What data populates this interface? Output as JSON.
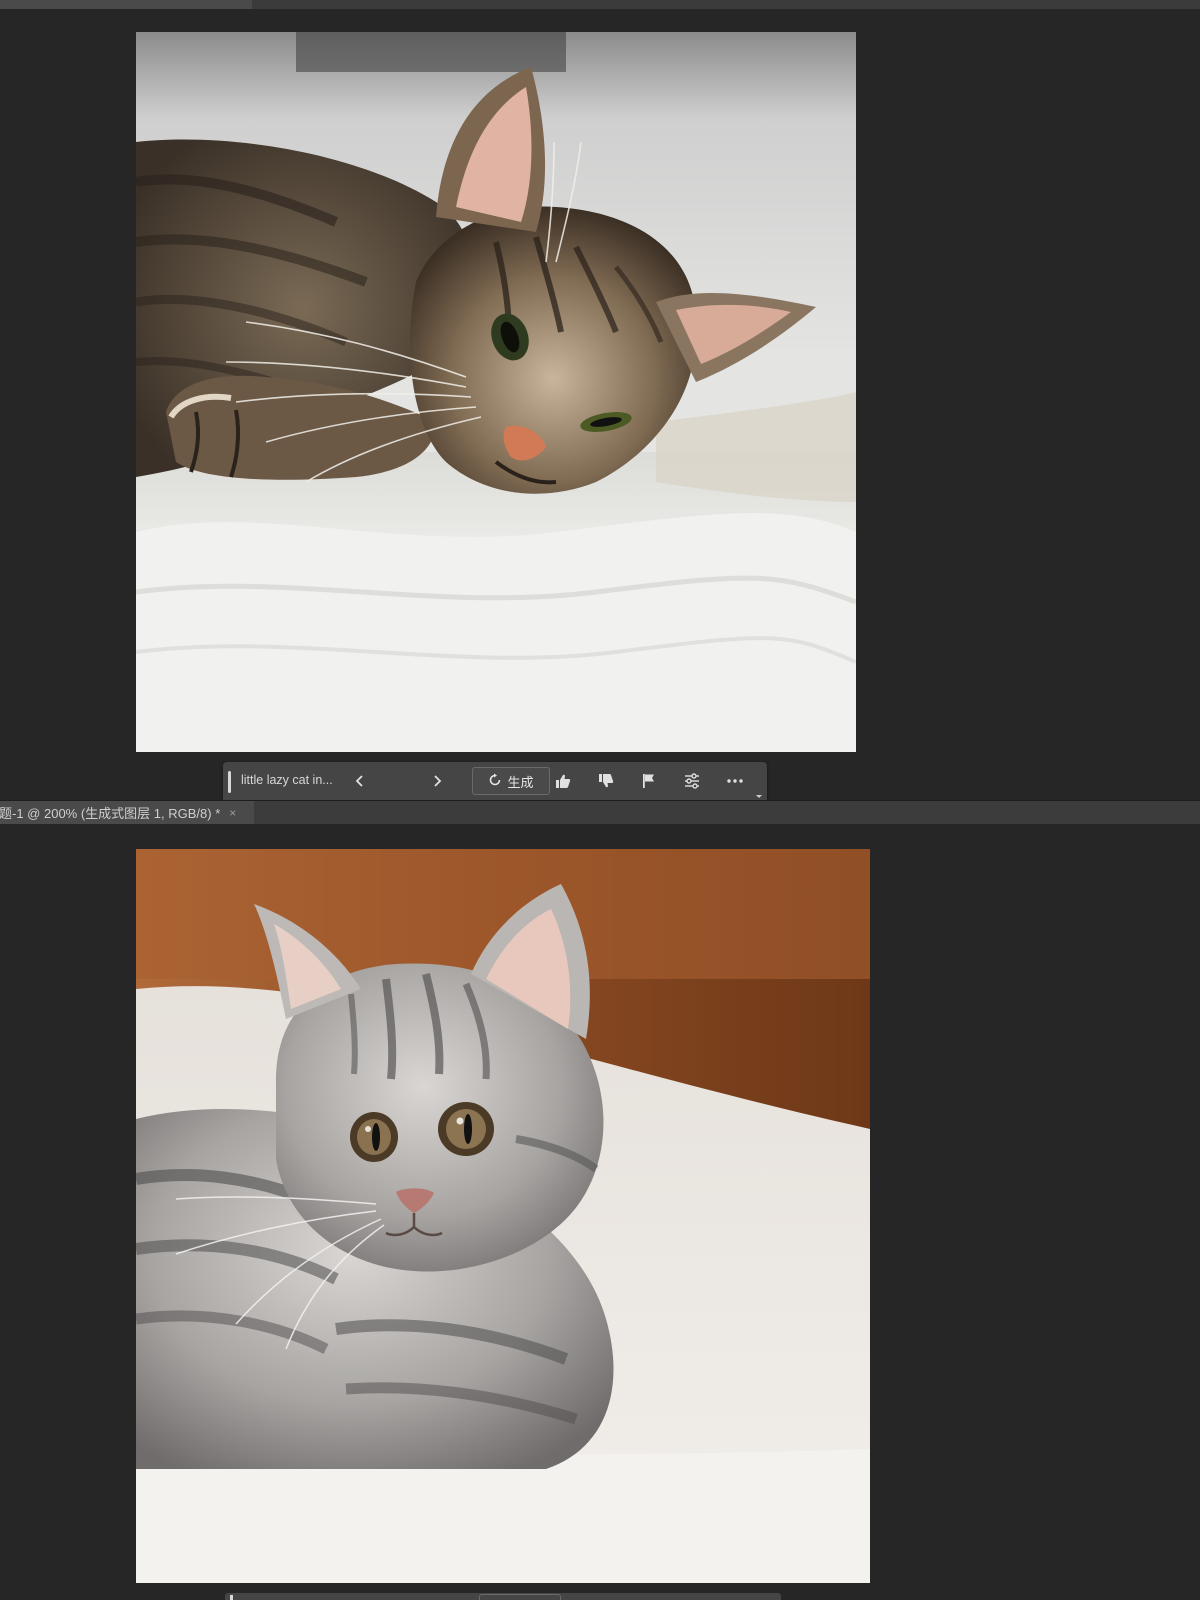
{
  "app": {
    "accent_color": "#262626",
    "canvas_background": "#262626"
  },
  "generative_toolbar": {
    "prompt_text": "little lazy cat in...",
    "previous_icon": "chevron-left-icon",
    "next_icon": "chevron-right-icon",
    "generate_label": "生成",
    "generate_icon": "refresh-icon",
    "thumbs_up_icon": "thumbs-up-icon",
    "thumbs_down_icon": "thumbs-down-icon",
    "flag_icon": "flag-icon",
    "settings_icon": "sliders-icon",
    "more_icon": "more-icon"
  },
  "document_tab": {
    "title": "题-1 @ 200% (生成式图层 1, RGB/8) *",
    "close_label": "×"
  },
  "images": {
    "top": "tabby-cat-lying-on-bed",
    "bottom": "gray-kitten-on-bed"
  }
}
